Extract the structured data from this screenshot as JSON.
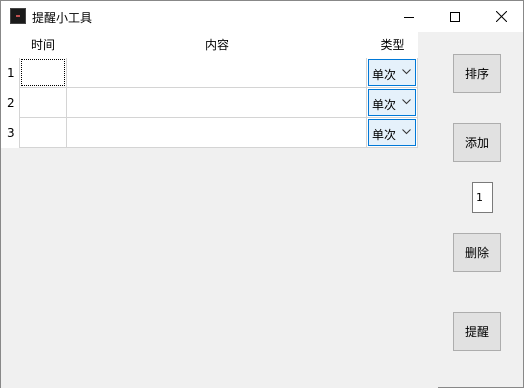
{
  "window": {
    "title": "提醒小工具",
    "icons": {
      "minimize": "minimize-icon",
      "maximize": "maximize-icon",
      "close": "close-icon"
    }
  },
  "table": {
    "headers": {
      "time": "时间",
      "content": "内容",
      "type": "类型"
    },
    "rows": [
      {
        "number": "1",
        "time": "",
        "content": "",
        "type": "单次"
      },
      {
        "number": "2",
        "time": "",
        "content": "",
        "type": "单次"
      },
      {
        "number": "3",
        "time": "",
        "content": "",
        "type": "单次"
      }
    ]
  },
  "buttons": {
    "sort": "排序",
    "add": "添加",
    "delete": "删除",
    "remind": "提醒"
  },
  "row_index_input": {
    "value": "1"
  },
  "colors": {
    "accent": "#0078d7",
    "combo_bg": "#e5f1fb",
    "button_bg": "#e1e1e1"
  }
}
